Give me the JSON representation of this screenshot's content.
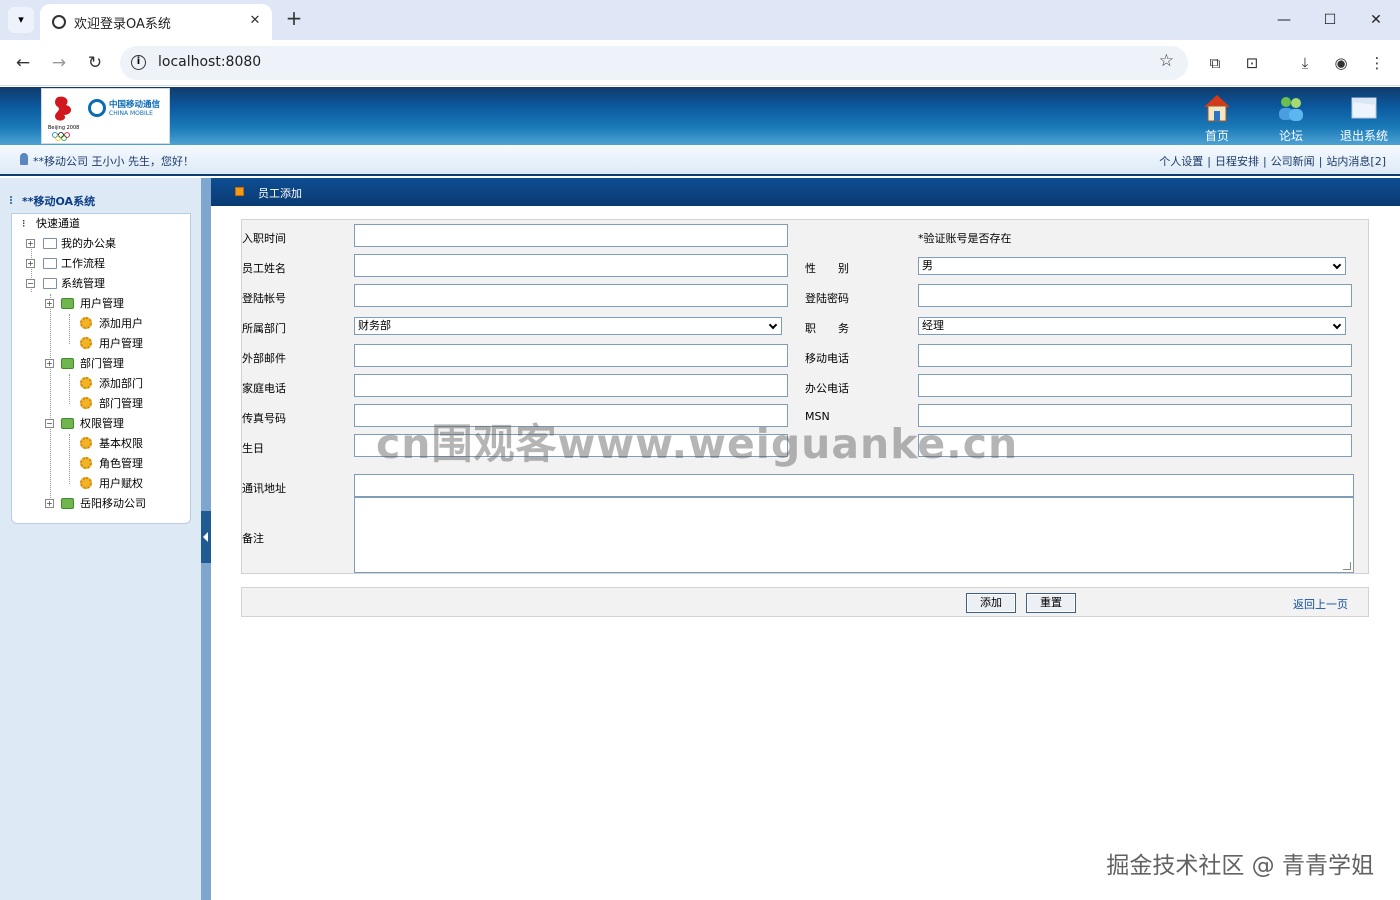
{
  "browser": {
    "tab_title": "欢迎登录OA系统",
    "url": "localhost:8080",
    "new_tab": "+",
    "close": "✕",
    "min": "—",
    "max": "☐",
    "exit": "✕"
  },
  "header": {
    "nav": [
      {
        "label": "首页",
        "icon": "home-icon"
      },
      {
        "label": "论坛",
        "icon": "users-icon"
      },
      {
        "label": "退出系统",
        "icon": "exit-icon"
      }
    ],
    "logo": {
      "cn": "中国移动通信",
      "en": "CHINA MOBILE",
      "beijing": "Beijing 2008"
    }
  },
  "userbar": {
    "greeting": "**移动公司 王小小 先生，您好！",
    "links": [
      "个人设置",
      "日程安排",
      "公司新闻",
      "站内消息[2]"
    ],
    "sep": "|"
  },
  "sidebar": {
    "title": "**移动OA系统",
    "tree": {
      "root": "快速通道",
      "items": [
        "我的办公桌",
        "工作流程",
        "系统管理",
        "用户管理",
        "添加用户",
        "用户管理",
        "部门管理",
        "添加部门",
        "部门管理",
        "权限管理",
        "基本权限",
        "角色管理",
        "用户赋权",
        "岳阳移动公司"
      ]
    }
  },
  "content": {
    "title": "员工添加",
    "form": {
      "hire_date": {
        "label": "入职时间",
        "value": ""
      },
      "verify_hint": "*验证账号是否存在",
      "name": {
        "label": "员工姓名",
        "value": ""
      },
      "gender": {
        "label": "性　　别",
        "value": "男"
      },
      "account": {
        "label": "登陆帐号",
        "value": ""
      },
      "password": {
        "label": "登陆密码",
        "value": ""
      },
      "department": {
        "label": "所属部门",
        "value": "财务部"
      },
      "position": {
        "label": "职　　务",
        "value": "经理"
      },
      "ext_email": {
        "label": "外部邮件",
        "value": ""
      },
      "mobile": {
        "label": "移动电话",
        "value": ""
      },
      "home_phone": {
        "label": "家庭电话",
        "value": ""
      },
      "office_phone": {
        "label": "办公电话",
        "value": ""
      },
      "fax": {
        "label": "传真号码",
        "value": ""
      },
      "msn": {
        "label": "MSN",
        "value": ""
      },
      "birthday": {
        "label": "生日",
        "value": ""
      },
      "address": {
        "label": "通讯地址",
        "value": ""
      },
      "remark": {
        "label": "备注",
        "value": ""
      }
    },
    "buttons": {
      "add": "添加",
      "reset": "重置",
      "back": "返回上一页"
    }
  },
  "watermarks": {
    "center": "cn围观客www.weiguanke.cn",
    "corner": "掘金技术社区 @ 青青学姐"
  },
  "colors": {
    "header_blue": "#0c5aa0",
    "sidebar_bg": "#dde9f5",
    "link_blue": "#1150a0",
    "accent_orange": "#f29a1e"
  }
}
